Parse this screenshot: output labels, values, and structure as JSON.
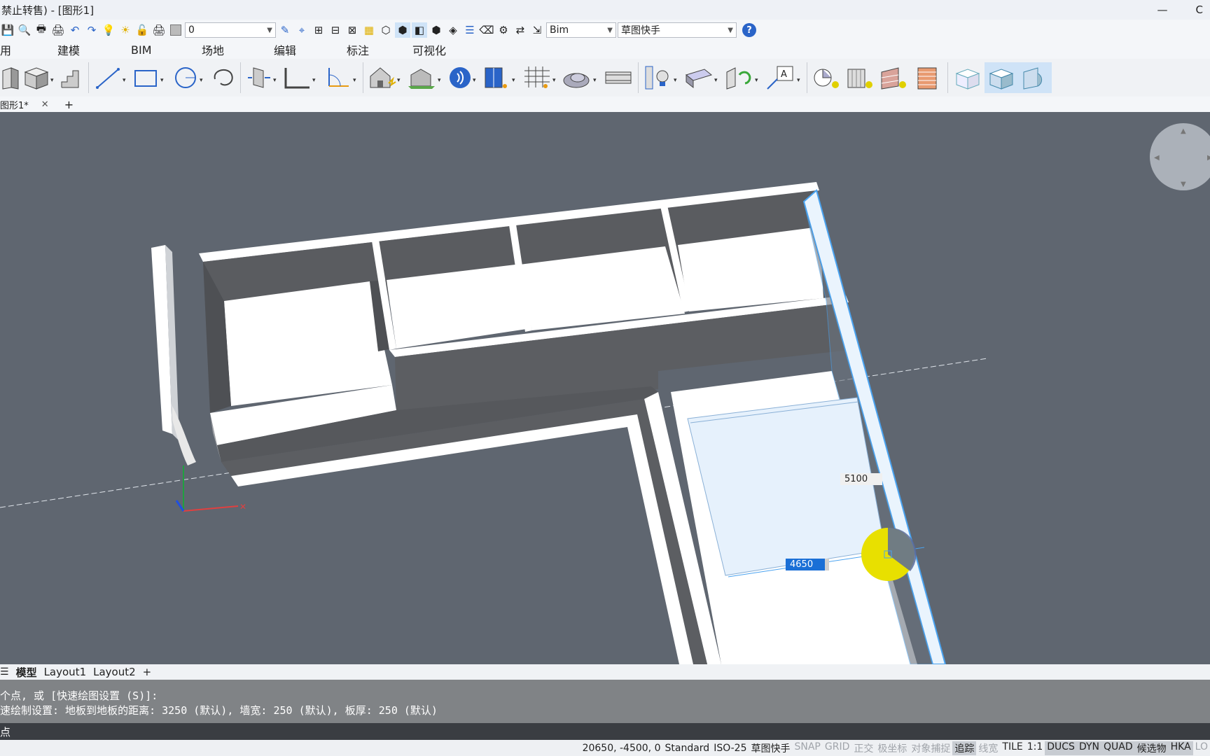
{
  "window": {
    "title": "禁止转售) - [图形1]",
    "controls": [
      "—",
      "C"
    ]
  },
  "quick_access": {
    "layer_value": "0",
    "workspace_value": "Bim",
    "quick_draw_value": "草图快手",
    "help_label": "?"
  },
  "ribbon_tabs": [
    "用",
    "建模",
    "BIM",
    "场地",
    "编辑",
    "标注",
    "可视化"
  ],
  "doc_tabs": {
    "active": "图形1*",
    "close": "✕",
    "add": "+"
  },
  "viewport": {
    "dim_length": "5100",
    "dim_width": "4650"
  },
  "layout_tabs": {
    "model": "模型",
    "layout1": "Layout1",
    "layout2": "Layout2",
    "add": "+"
  },
  "command": {
    "history": [
      "个点, 或 [快速绘图设置 (S)]:",
      "速绘制设置: 地板到地板的距离: 3250 (默认), 墙宽: 250 (默认), 板厚: 250 (默认)"
    ],
    "prompt": "点"
  },
  "status_bar": {
    "coords": "20650, -4500, 0",
    "text_style": "Standard",
    "dim_style": "ISO-25",
    "workspace": "草图快手",
    "toggles": [
      {
        "label": "SNAP",
        "state": "off"
      },
      {
        "label": "GRID",
        "state": "off"
      },
      {
        "label": "正交",
        "state": "off"
      },
      {
        "label": "极坐标",
        "state": "off"
      },
      {
        "label": "对象捕捉",
        "state": "off"
      },
      {
        "label": "追踪",
        "state": "on"
      },
      {
        "label": "线宽",
        "state": "off"
      },
      {
        "label": "TILE",
        "state": "normal"
      },
      {
        "label": "1:1",
        "state": "normal"
      },
      {
        "label": "DUCS",
        "state": "on"
      },
      {
        "label": "DYN",
        "state": "on"
      },
      {
        "label": "QUAD",
        "state": "on"
      },
      {
        "label": "候选物",
        "state": "on"
      },
      {
        "label": "HKA",
        "state": "on"
      },
      {
        "label": "LO",
        "state": "off"
      }
    ]
  },
  "colors": {
    "viewport_bg": "#5f6670",
    "selection_blue": "#4aa3f0",
    "accent_yellow": "#e8e000"
  }
}
